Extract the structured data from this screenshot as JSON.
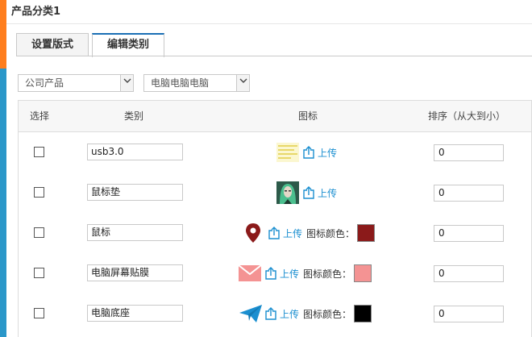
{
  "title": "产品分类1",
  "tabs": [
    {
      "label": "设置版式",
      "active": false
    },
    {
      "label": "编辑类别",
      "active": true
    }
  ],
  "filters": {
    "company": "公司产品",
    "category": "电脑电脑电脑"
  },
  "table": {
    "headers": {
      "select": "选择",
      "category": "类别",
      "icon": "图标",
      "order": "排序（从大到小）"
    },
    "upload_label": "上传",
    "color_label": "图标颜色：",
    "rows": [
      {
        "name": "usb3.0",
        "order": "0",
        "icon": "image-thumbnail-icon",
        "color": null
      },
      {
        "name": "鼠标垫",
        "order": "0",
        "icon": "avatar-image-icon",
        "color": null
      },
      {
        "name": "鼠标",
        "order": "0",
        "icon": "map-marker-icon",
        "color": "#8b1a1a"
      },
      {
        "name": "电脑屏幕贴膜",
        "order": "0",
        "icon": "envelope-icon",
        "color": "#f49393"
      },
      {
        "name": "电脑底座",
        "order": "0",
        "icon": "paper-plane-icon",
        "color": "#000000"
      }
    ]
  }
}
